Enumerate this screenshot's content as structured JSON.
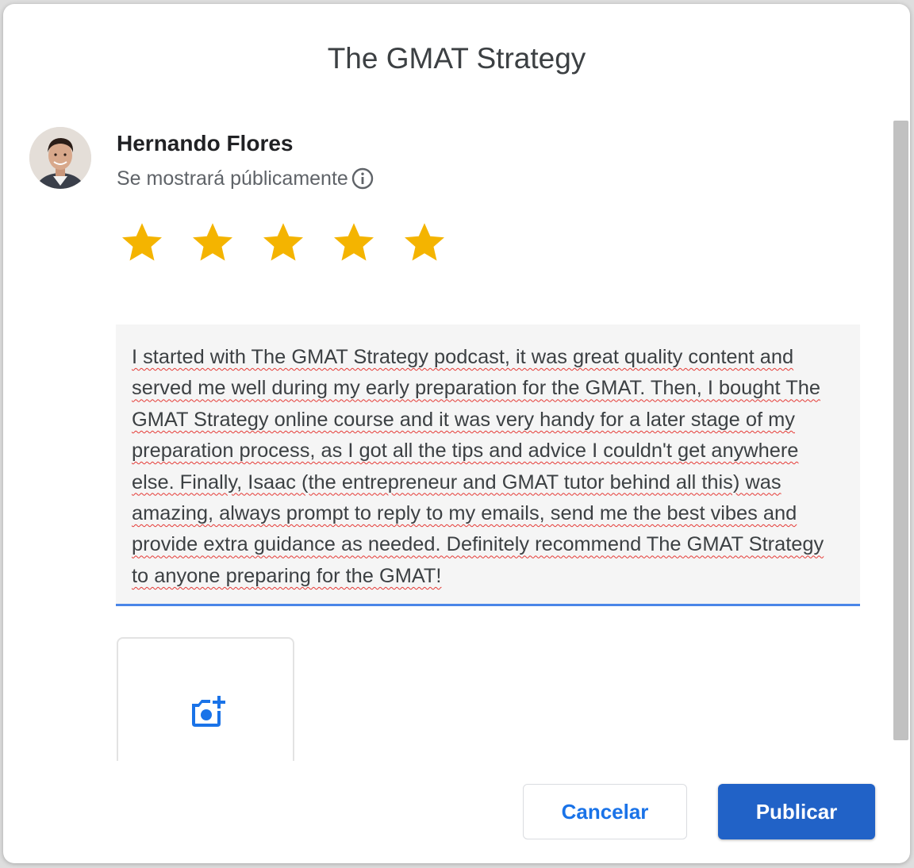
{
  "dialog": {
    "title": "The GMAT Strategy"
  },
  "user": {
    "name": "Hernando Flores",
    "visibility_note": "Se mostrará públicamente"
  },
  "rating": {
    "value": 5,
    "max": 5,
    "star_color": "#f4b400"
  },
  "review": {
    "text": "I started with The GMAT Strategy podcast, it was great quality content and served me well during my early preparation for the GMAT. Then, I bought The GMAT Strategy online course and it was very handy for a later stage of my preparation process, as I got all the tips and advice I couldn't get anywhere else. Finally, Isaac (the entrepreneur and GMAT tutor behind all this) was amazing, always prompt to reply to my emails, send me the best vibes and provide extra guidance as needed. Definitely recommend The GMAT Strategy to anyone preparing for the GMAT!"
  },
  "photo": {
    "icon": "add-photo-icon"
  },
  "actions": {
    "cancel_label": "Cancelar",
    "publish_label": "Publicar"
  },
  "colors": {
    "accent": "#2162c7",
    "link": "#1a73e8",
    "underline": "#4a86e8"
  }
}
